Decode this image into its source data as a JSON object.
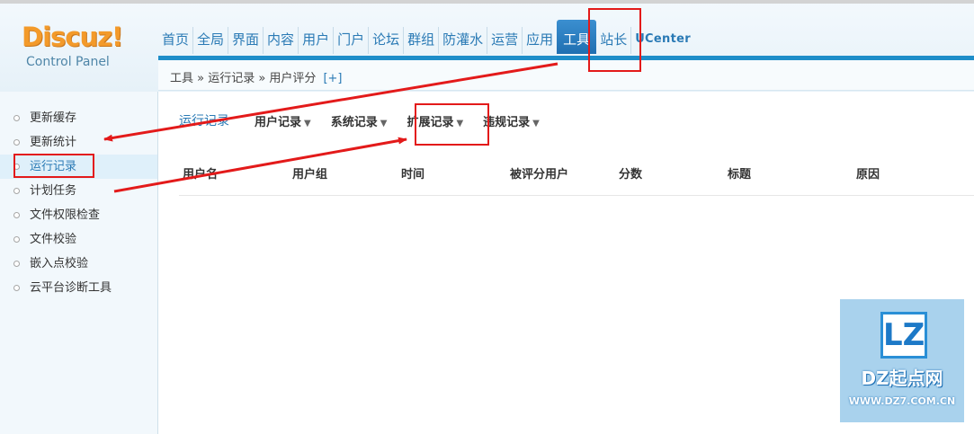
{
  "logo": {
    "main": "Discuz!",
    "sub": "Control Panel"
  },
  "nav": {
    "items": [
      "首页",
      "全局",
      "界面",
      "内容",
      "用户",
      "门户",
      "论坛",
      "群组",
      "防灌水",
      "运营",
      "应用",
      "工具",
      "站长",
      "UCenter"
    ],
    "active": "工具"
  },
  "breadcrumb": {
    "text": "工具 » 运行记录 » 用户评分",
    "plus": "[+]"
  },
  "sidebar": {
    "items": [
      "更新缓存",
      "更新统计",
      "运行记录",
      "计划任务",
      "文件权限检查",
      "文件校验",
      "嵌入点校验",
      "云平台诊断工具"
    ],
    "active": "运行记录"
  },
  "subnav": {
    "title": "运行记录",
    "items": [
      "用户记录",
      "系统记录",
      "扩展记录",
      "违规记录"
    ],
    "caret": "▼"
  },
  "table": {
    "columns": [
      "用户名",
      "用户组",
      "时间",
      "被评分用户",
      "分数",
      "标题",
      "原因"
    ]
  },
  "watermark": {
    "logo": "LZ",
    "title": "DZ起点网",
    "url": "WWW.DZ7.COM.CN"
  },
  "colors": {
    "accent": "#1e8dc9",
    "link": "#2a7ab5",
    "annotation": "#e31a1a",
    "logo": "#f39a2a"
  }
}
